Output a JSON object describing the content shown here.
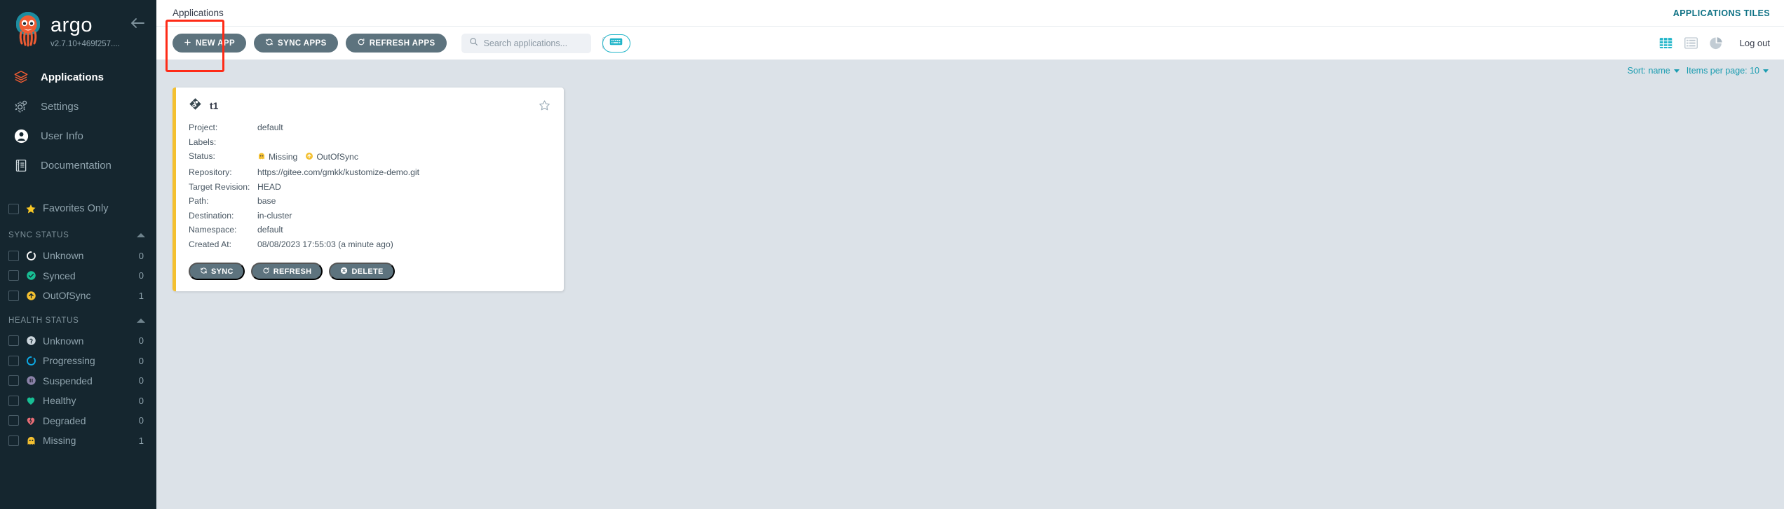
{
  "sidebar": {
    "brand_name": "argo",
    "version": "v2.7.10+469f257....",
    "collapse_icon": "arrow-left-icon",
    "nav": [
      {
        "label": "Applications",
        "icon": "stack-layers-icon",
        "active": true
      },
      {
        "label": "Settings",
        "icon": "gear-icon",
        "active": false
      },
      {
        "label": "User Info",
        "icon": "user-circle-icon",
        "active": false
      },
      {
        "label": "Documentation",
        "icon": "book-question-icon",
        "active": false
      }
    ],
    "favorites": {
      "label": "Favorites Only",
      "icon": "star-filled-icon",
      "checked": false
    },
    "sync_status": {
      "title": "SYNC STATUS",
      "collapse_icon": "caret-up-icon",
      "items": [
        {
          "label": "Unknown",
          "count": "0",
          "icon": "circle-notch-icon",
          "color": "#ffffff"
        },
        {
          "label": "Synced",
          "count": "0",
          "icon": "check-circle-icon",
          "color": "#18be94"
        },
        {
          "label": "OutOfSync",
          "count": "1",
          "icon": "arrow-up-circle-icon",
          "color": "#f4c030"
        }
      ]
    },
    "health_status": {
      "title": "HEALTH STATUS",
      "collapse_icon": "caret-up-icon",
      "items": [
        {
          "label": "Unknown",
          "count": "0",
          "icon": "question-circle-icon",
          "color": "#ccd6dd"
        },
        {
          "label": "Progressing",
          "count": "0",
          "icon": "circle-notch-icon",
          "color": "#0dadea"
        },
        {
          "label": "Suspended",
          "count": "0",
          "icon": "pause-circle-icon",
          "color": "#766f94"
        },
        {
          "label": "Healthy",
          "count": "0",
          "icon": "heart-icon",
          "color": "#18be94"
        },
        {
          "label": "Degraded",
          "count": "0",
          "icon": "heart-broken-icon",
          "color": "#e96d76"
        },
        {
          "label": "Missing",
          "count": "1",
          "icon": "ghost-icon",
          "color": "#f4c030"
        }
      ]
    }
  },
  "topbar": {
    "breadcrumb": "Applications",
    "right_label": "APPLICATIONS TILES"
  },
  "toolbar": {
    "new_app_label": "NEW APP",
    "new_app_icon": "plus-icon",
    "sync_apps_label": "SYNC APPS",
    "sync_apps_icon": "sync-icon",
    "refresh_apps_label": "REFRESH APPS",
    "refresh_apps_icon": "refresh-icon",
    "search_placeholder": "Search applications...",
    "search_value": "",
    "search_icon": "search-icon",
    "search_shortcut": "/",
    "keyboard_button_icon": "keyboard-icon",
    "view_tiles_icon": "grid-tiles-icon",
    "view_list_icon": "list-icon",
    "view_summary_icon": "pie-chart-icon",
    "logout_label": "Log out",
    "accent_color": "#21b5c9"
  },
  "sortbar": {
    "sort_label": "Sort: name",
    "items_per_page_label": "Items per page: 10",
    "link_color": "#1a9cb0"
  },
  "application": {
    "name": "t1",
    "app_icon": "kustomize-diamond-icon",
    "favorite_icon": "star-outline-icon",
    "border_color": "#f4c030",
    "fields": [
      {
        "key": "Project:",
        "value": "default"
      },
      {
        "key": "Labels:",
        "value": ""
      },
      {
        "key": "Repository:",
        "value": "https://gitee.com/gmkk/kustomize-demo.git"
      },
      {
        "key": "Target Revision:",
        "value": "HEAD"
      },
      {
        "key": "Path:",
        "value": "base"
      },
      {
        "key": "Destination:",
        "value": "in-cluster"
      },
      {
        "key": "Namespace:",
        "value": "default"
      },
      {
        "key": "Created At:",
        "value": "08/08/2023 17:55:03  (a minute ago)"
      }
    ],
    "status_key": "Status:",
    "status": [
      {
        "label": "Missing",
        "icon": "ghost-icon",
        "color": "#f4c030"
      },
      {
        "label": "OutOfSync",
        "icon": "arrow-up-circle-icon",
        "color": "#f4c030"
      }
    ],
    "actions": [
      {
        "label": "SYNC",
        "icon": "sync-icon"
      },
      {
        "label": "REFRESH",
        "icon": "refresh-icon"
      },
      {
        "label": "DELETE",
        "icon": "delete-circle-icon"
      }
    ]
  },
  "annotation": {
    "highlight_color": "#fe2b17",
    "target": "new-app-button"
  }
}
